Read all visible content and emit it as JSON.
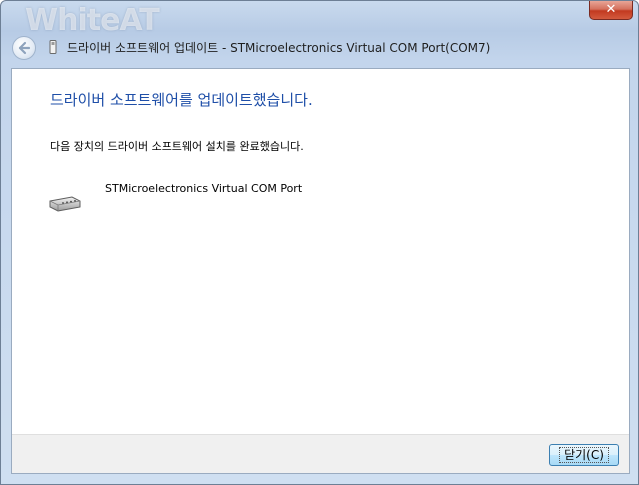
{
  "window": {
    "watermark": "WhiteAT",
    "title": "드라이버 소프트웨어 업데이트 - STMicroelectronics Virtual COM Port(COM7)",
    "close_glyph": "✕"
  },
  "main": {
    "heading": "드라이버 소프트웨어를 업데이트했습니다.",
    "message": "다음 장치의 드라이버 소프트웨어 설치를 완료했습니다.",
    "device_name": "STMicroelectronics Virtual COM Port"
  },
  "footer": {
    "close_label": "닫기(C)"
  },
  "icons": {
    "back": "back-arrow-icon",
    "title": "usb-device-icon",
    "device": "serial-port-icon"
  }
}
